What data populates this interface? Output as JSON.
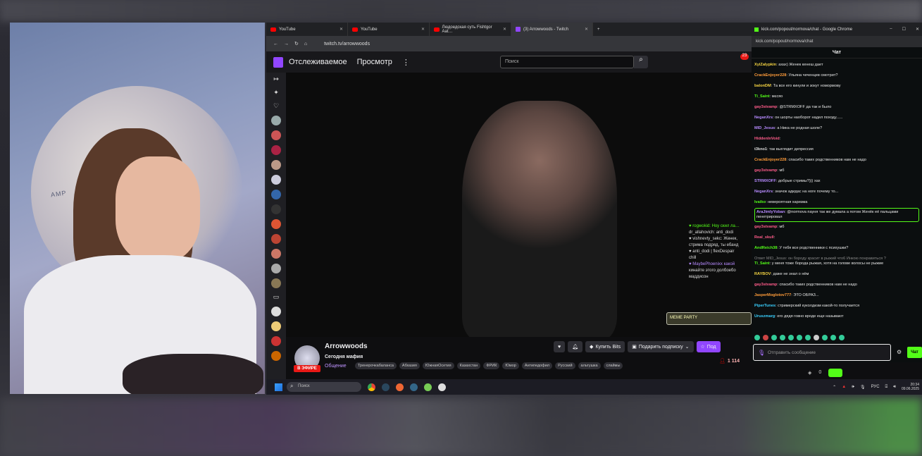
{
  "browser": {
    "tabs": [
      {
        "label": "YouTube",
        "icon": "youtube-icon"
      },
      {
        "label": "YouTube",
        "icon": "youtube-icon"
      },
      {
        "label": "Людоедская суть Fishtgor Aat…",
        "icon": "youtube-icon"
      },
      {
        "label": "(3) Arrowwoods - Twitch",
        "icon": "twitch-icon"
      }
    ],
    "url": "twitch.tv/arrowwoods"
  },
  "twitch": {
    "nav": [
      "Отслеживаемое",
      "Просмотр"
    ],
    "search_placeholder": "Поиск",
    "notifications": "23",
    "channel": "Arrowwoods",
    "stream_title": "Сегодня мафия",
    "category": "Общение",
    "live_label": "В ЭФИРЕ",
    "tags": [
      "Тренерочкабаланса",
      "Абхазия",
      "ЮжнаяОсетия",
      "Казахстан",
      "ФРИК",
      "Юмор",
      "Антипедофил",
      "Русский",
      "альтушка",
      "слаймы"
    ],
    "bits_label": "Купить Bits",
    "gift_label": "Подарить подписку",
    "sub_label": "Под",
    "viewers": "1 114",
    "overlay_chat": [
      "♥ rogwokid: Ноу скил ла…",
      "dr_allahovich: anti_dodi",
      "♥ vishnevty_sekc: Женек,",
      "стрима подряд, ты ебанд",
      "♥ anti_dodi | flexDespair",
      "chill",
      "♥ MaybePhoenixx какой",
      "кинайте этого долбоебо",
      "маддисон"
    ],
    "meme_label": "MEME PARTY"
  },
  "kick": {
    "window_title": "kick.com/popout/normova/chat - Google Chrome",
    "url": "kick.com/popout/normova/chat",
    "chat_title": "Чат",
    "messages": [
      {
        "user": "XyiZalypkin",
        "color": "#f5d442",
        "text": "ахах) Женек кенеш дает"
      },
      {
        "user": "CrackEnjoyer228",
        "color": "#ff9c3a",
        "text": "Ульяна чеченцев смотрит?"
      },
      {
        "user": "balonDM",
        "color": "#f5d442",
        "text": "Та все его кинули и зокут номормову"
      },
      {
        "user": "Ti_Saint",
        "color": "#53fc18",
        "text": "мєсяо"
      },
      {
        "user": "gay3stvamp",
        "color": "#ff5c8a",
        "text": "@STRMXOFF да так и было"
      },
      {
        "user": "NeganXrs",
        "color": "#b78bff",
        "text": "он шорты наоборот надел походу......"
      },
      {
        "user": "MID_Jesus",
        "color": "#b78bff",
        "text": "а Ника не родная шоле?"
      },
      {
        "user": "HiddenInVoid",
        "color": "#ff5c8a",
        "text": ""
      },
      {
        "user": "t3kno1",
        "color": "#dddddd",
        "text": "так выглядит депрессия"
      },
      {
        "user": "CrackEnjoyer228",
        "color": "#ff9c3a",
        "text": "спасибо таких родственников нам не надо"
      },
      {
        "user": "gay3stvamp",
        "color": "#ff5c8a",
        "text": "мб"
      },
      {
        "user": "STRMXOFF",
        "color": "#b78bff",
        "text": "добрые стримы?))) хах"
      },
      {
        "user": "NeganXrs",
        "color": "#b78bff",
        "text": "значок адидас на ноге почему то..."
      },
      {
        "user": "Ivaiko",
        "color": "#53fc18",
        "text": "невероятная харизма"
      },
      {
        "user": "AraJimlyYoban",
        "color": "#b78bff",
        "text": "@normova пауня так же думала а потом Женёк её пальцами пенетрировал",
        "highlight": true
      },
      {
        "user": "gay3stvamp",
        "color": "#ff5c8a",
        "text": "мб"
      },
      {
        "user": "Real_skull",
        "color": "#ff5c8a",
        "text": ""
      },
      {
        "user": "AndReich38",
        "color": "#53fc18",
        "text": "У тебя все родственники с психушки?"
      },
      {
        "user": "Ti_Saint",
        "color": "#53fc18",
        "text": "у меня тоже борода рыжая, хотя на голове волосы не рыжие",
        "reply": "Ответ MID_Jesus: он бороду красит в рыжий что6 Инкою понравиться ?"
      },
      {
        "user": "RAYBOV",
        "color": "#f5d442",
        "text": "даже не знал о нём"
      },
      {
        "user": "gay3stvamp",
        "color": "#ff5c8a",
        "text": "спасибо таких родственников нам не надо"
      },
      {
        "user": "JasperMoglotov777",
        "color": "#ff9c3a",
        "text": "ЭТО ОБРАЗ..."
      },
      {
        "user": "PiperTunes",
        "color": "#3ad1ff",
        "text": "стримерский куколдизм какой-то получается"
      },
      {
        "user": "Uruszmarg",
        "color": "#3ad1ff",
        "text": "его дядя говно вроде еще называют"
      }
    ],
    "input_placeholder": "Отправить сообщение",
    "send_label": "Чат",
    "points": "0"
  },
  "taskbar": {
    "search_placeholder": "Поиск",
    "lang": "РУС",
    "time": "20:34",
    "date": "09.06.2025"
  },
  "webcam": {
    "chair_brand": "AMP"
  }
}
